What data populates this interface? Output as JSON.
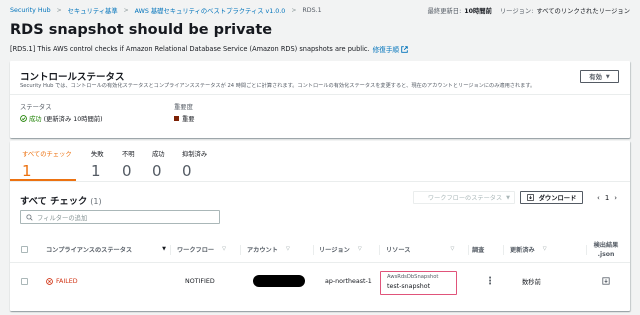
{
  "breadcrumb": {
    "items": [
      "Security Hub",
      "セキュリティ基準",
      "AWS 基礎セキュリティのベストプラクティス v1.0.0"
    ],
    "current": "RDS.1"
  },
  "header_meta": {
    "last_updated_label": "最終更新日:",
    "last_updated_value": "10時間前",
    "region_label": "リージョン:",
    "region_value": "すべてのリンクされたリージョン"
  },
  "page": {
    "title": "RDS snapshot should be private",
    "description": "[RDS.1] This AWS control checks if Amazon Relational Database Service (Amazon RDS) snapshots are public.",
    "remediation_link": "修復手順"
  },
  "control_status": {
    "title": "コントロールステータス",
    "subtitle": "Security Hub では、コントロールの有効化ステータスとコンプライアンスステータスが 24 時間ごとに計算されます。コントロールの有効化ステータスを変更すると、現在のアカウントとリージョンにのみ適用されます。",
    "state_button": "有効",
    "status_label": "ステータス",
    "status_value": "成功",
    "status_detail": "(更新済み 10時間前)",
    "severity_label": "重要度",
    "severity_value": "重要",
    "colors": {
      "success": "#1d8102",
      "critical": "#7d2105",
      "failed": "#d13212",
      "accent": "#ec7211",
      "link": "#0073bb"
    }
  },
  "counters": [
    {
      "label": "すべてのチェック",
      "value": "1"
    },
    {
      "label": "失敗",
      "value": "1"
    },
    {
      "label": "不明",
      "value": "0"
    },
    {
      "label": "成功",
      "value": "0"
    },
    {
      "label": "抑制済み",
      "value": "0"
    }
  ],
  "checks": {
    "title": "すべて チェック",
    "count": "(1)",
    "workflow_select_placeholder": "ワークフローのステータス",
    "download_button": "ダウンロード",
    "page_number": "1",
    "filter_placeholder": "フィルターの追加",
    "columns": {
      "compliance": "コンプライアンスのステータス",
      "workflow": "ワークフロー",
      "account": "アカウント",
      "region": "リージョン",
      "resource": "リソース",
      "investigate": "調査",
      "updated": "更新済み",
      "export_line1": "検出結果",
      "export_line2": ".json"
    },
    "rows": [
      {
        "compliance": "FAILED",
        "workflow": "NOTIFIED",
        "account": "",
        "region": "ap-northeast-1",
        "resource_type": "AwsRdsDbSnapshot",
        "resource_id": "test-snapshot",
        "updated": "数秒前"
      }
    ]
  },
  "icons": [
    "external-link-icon",
    "success-check-icon",
    "caret-down-icon",
    "download-icon",
    "search-icon",
    "sort-icon",
    "failed-icon",
    "kebab-menu-icon",
    "export-json-icon",
    "chevron-left-icon",
    "chevron-right-icon"
  ]
}
